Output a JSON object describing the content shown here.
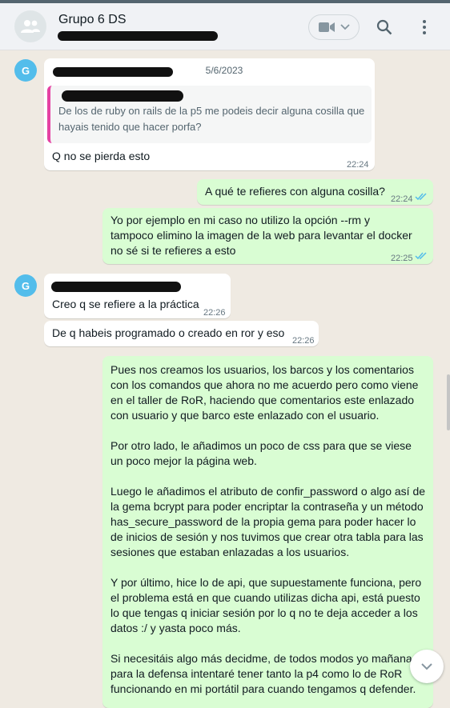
{
  "header": {
    "title": "Grupo 6 DS"
  },
  "date_pill": "5/6/2023",
  "messages": {
    "m1": {
      "avatar_letter": "G",
      "quote_text": "De los de ruby on rails de la p5 me podeis decir alguna cosilla que hayais tenido que hacer porfa?",
      "text": "Q no se pierda esto",
      "time": "22:24"
    },
    "m2": {
      "text": "A qué te refieres con alguna cosilla?",
      "time": "22:24"
    },
    "m3": {
      "text": "Yo por ejemplo en mi caso no utilizo la opción --rm y tampoco elimino la imagen de la web para levantar el docker no sé si te refieres a esto",
      "time": "22:25"
    },
    "m4": {
      "avatar_letter": "G",
      "text": "Creo q se refiere a la práctica",
      "time": "22:26"
    },
    "m5": {
      "text": "De q habeis programado o creado en ror y eso",
      "time": "22:26"
    },
    "m6": {
      "p1": "Pues nos creamos los usuarios, los barcos y los comentarios con los comandos que ahora no me acuerdo pero como viene en el taller de RoR, haciendo que comentarios este enlazado con usuario y que barco este enlazado con el usuario.",
      "p2": "Por otro lado, le añadimos un poco de css para que se viese un poco mejor la página web.",
      "p3": "Luego le añadimos el atributo de confir_password o algo así de la gema bcrypt para poder encriptar la contraseña y un método has_secure_password de la propia gema para poder hacer lo de inicios de sesión y nos tuvimos que crear otra tabla para las sesiones que estaban enlazadas a los usuarios.",
      "p4": "Y por último, hice lo de api, que supuestamente funciona, pero el problema está en que cuando utilizas dicha api, está puesto lo que tengas q iniciar sesión por lo q no te deja acceder a los datos :/ y yasta poco más.",
      "p5": "Si necesitáis algo más decidme, de todos modos yo mañana para la defensa intentaré tener tanto la p4 como lo de RoR funcionando en mi portátil para cuando tengamos q defender."
    }
  },
  "colors": {
    "incoming_bubble": "#ffffff",
    "outgoing_bubble": "#d9fdd3",
    "chat_background": "#efeae2",
    "avatar": "#53bdeb",
    "read_ticks": "#53bdeb",
    "quote_bar": "#e542a3"
  },
  "icons": [
    "group-icon",
    "video-call-icon",
    "chevron-down-icon",
    "search-icon",
    "menu-icon",
    "double-check-icon",
    "scroll-down-icon"
  ]
}
